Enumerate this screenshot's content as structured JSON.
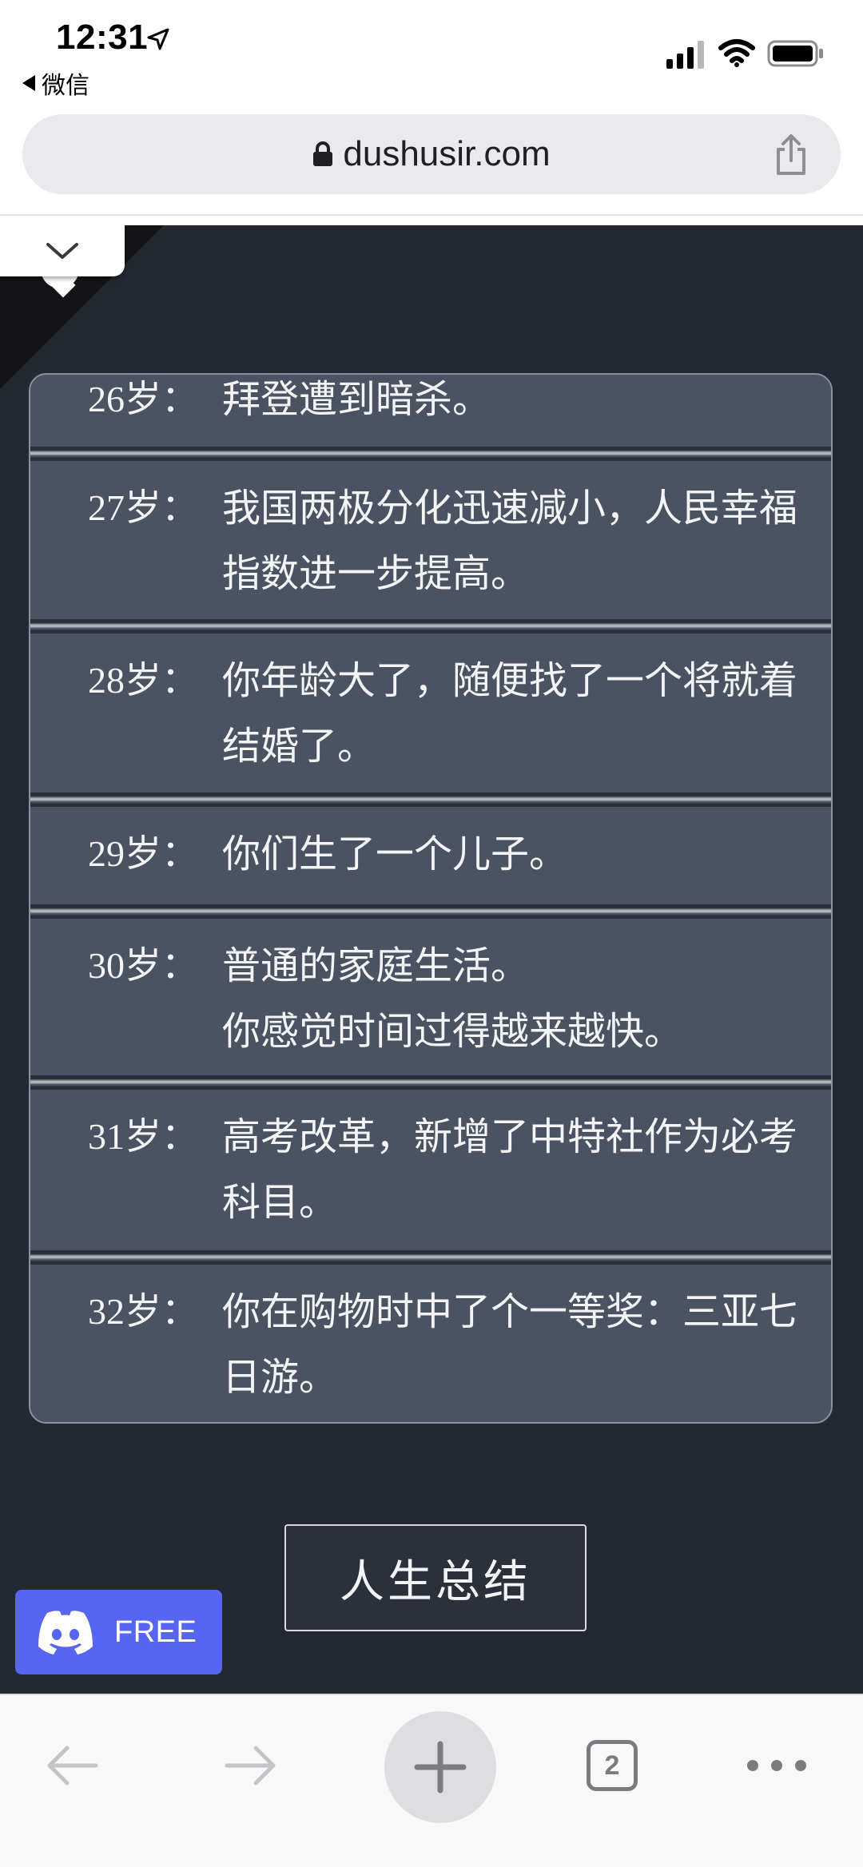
{
  "status_bar": {
    "time": "12:31",
    "back_app_label": "微信"
  },
  "browser": {
    "url": "dushusir.com",
    "open_tabs_count": "2"
  },
  "events": [
    {
      "age": "26岁：",
      "text": "拜登遭到暗杀。"
    },
    {
      "age": "27岁：",
      "text": "我国两极分化迅速减小，人民幸福指数进一步提高。"
    },
    {
      "age": "28岁：",
      "text": "你年龄大了，随便找了一个将就着结婚了。"
    },
    {
      "age": "29岁：",
      "text": "你们生了一个儿子。"
    },
    {
      "age": "30岁：",
      "text": "普通的家庭生活。\n你感觉时间过得越来越快。"
    },
    {
      "age": "31岁：",
      "text": "高考改革，新增了中特社作为必考科目。"
    },
    {
      "age": "32岁：",
      "text": "你在购物时中了个一等奖：三亚七日游。"
    }
  ],
  "summary_button_label": "人生总结",
  "discord_badge": {
    "label": "FREE",
    "color": "#5865f2"
  },
  "colors": {
    "page_background": "#242833",
    "card_background": "#4b5261",
    "text": "#f3f4f6"
  }
}
